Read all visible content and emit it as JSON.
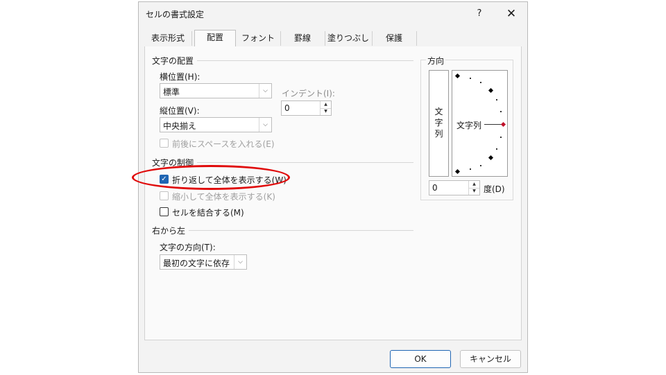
{
  "dialog": {
    "title": "セルの書式設定",
    "help": "?",
    "close": "✕"
  },
  "tabs": [
    "表示形式",
    "配置",
    "フォント",
    "罫線",
    "塗りつぶし",
    "保護"
  ],
  "text_alignment": {
    "group": "文字の配置",
    "horizontal_label": "横位置(H):",
    "horizontal_value": "標準",
    "indent_label": "インデント(I):",
    "indent_value": "0",
    "vertical_label": "縦位置(V):",
    "vertical_value": "中央揃え",
    "distributed_label": "前後にスペースを入れる(E)"
  },
  "text_control": {
    "group": "文字の制御",
    "wrap_label": "折り返して全体を表示する(W)",
    "wrap_checked": true,
    "shrink_label": "縮小して全体を表示する(K)",
    "merge_label": "セルを結合する(M)"
  },
  "rtl": {
    "group": "右から左",
    "direction_label": "文字の方向(T):",
    "direction_value": "最初の文字に依存"
  },
  "orientation": {
    "group": "方向",
    "vertical_chars": [
      "文",
      "字",
      "列"
    ],
    "horizontal_text": "文字列",
    "degrees_value": "0",
    "degrees_label": "度(D)"
  },
  "buttons": {
    "ok": "OK",
    "cancel": "キャンセル"
  },
  "colors": {
    "accent": "#1f65b3",
    "annotation": "#e00a0a"
  }
}
